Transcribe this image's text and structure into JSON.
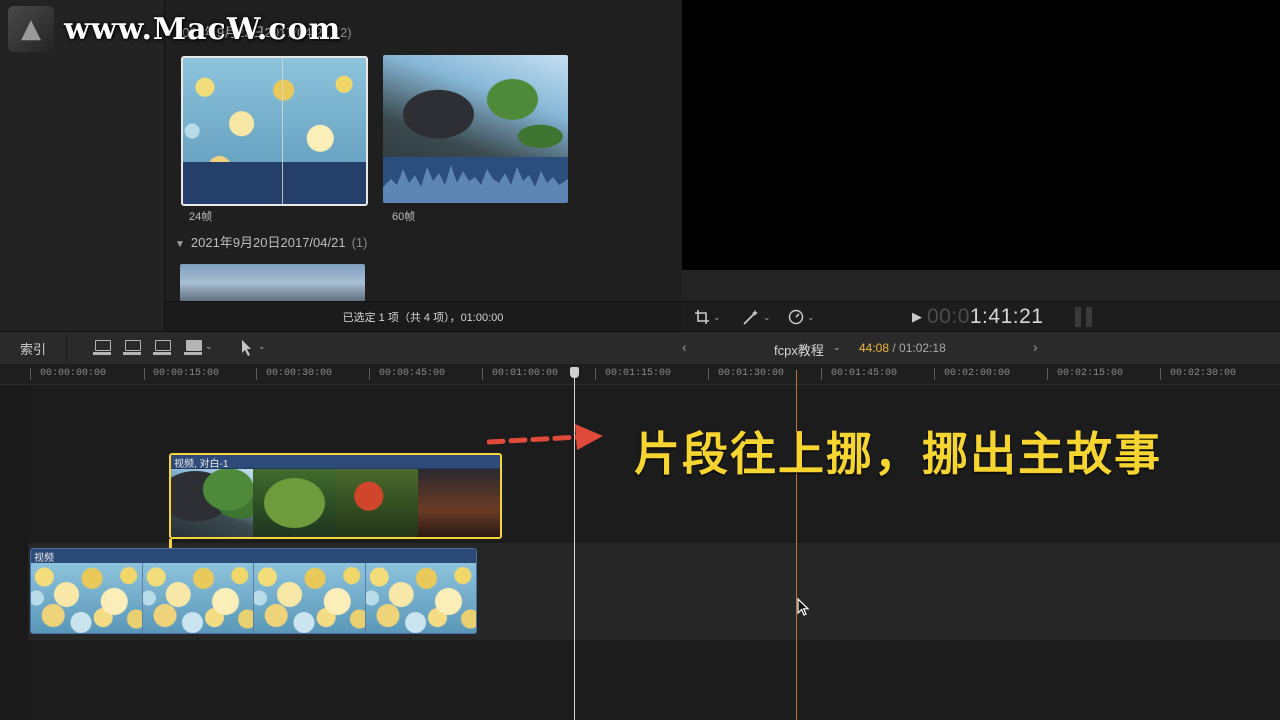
{
  "watermark": {
    "logo_glyph": "▲",
    "text": "www.MacW.com"
  },
  "browser": {
    "group1": {
      "label": "2021年9月23日2017/04/21",
      "count": "(2)"
    },
    "group2": {
      "label": "2021年9月20日2017/04/21",
      "count": "(1)",
      "expand_icon": "disclosure-triangle-icon"
    },
    "clips": [
      {
        "name": "flowers-clip",
        "duration_label": "24帧"
      },
      {
        "name": "temple-clip",
        "duration_label": "60帧"
      }
    ],
    "status": "已选定 1 项（共 4 项），01:00:00"
  },
  "viewer": {
    "timecode_dim": "00:0",
    "timecode_bright": "1:41:21"
  },
  "timeline_toolbar": {
    "index_label": "索引",
    "project_name": "fcpx教程",
    "current_time": "44:08",
    "total_time": "/ 01:02:18",
    "prev_glyph": "‹",
    "next_glyph": "›"
  },
  "ruler": {
    "labels": [
      "00:00:00:00",
      "00:00:15:00",
      "00:00:30:00",
      "00:00:45:00",
      "00:01:00:00",
      "00:01:15:00",
      "00:01:30:00",
      "00:01:45:00",
      "00:02:00:00",
      "00:02:15:00",
      "00:02:30:00"
    ]
  },
  "timeline": {
    "connected_clip_title": "视频, 对白-1",
    "primary_clip_title": "视频"
  },
  "annotation": {
    "text": "片段往上挪，挪出主故事",
    "color": "#f7d531",
    "arrow_color": "#e04a3a"
  },
  "colors": {
    "selection_outline": "#f5d33a",
    "playhead": "#d8d8d8",
    "skimmer": "#c2733b",
    "clip_blue": "#2c4a78"
  }
}
